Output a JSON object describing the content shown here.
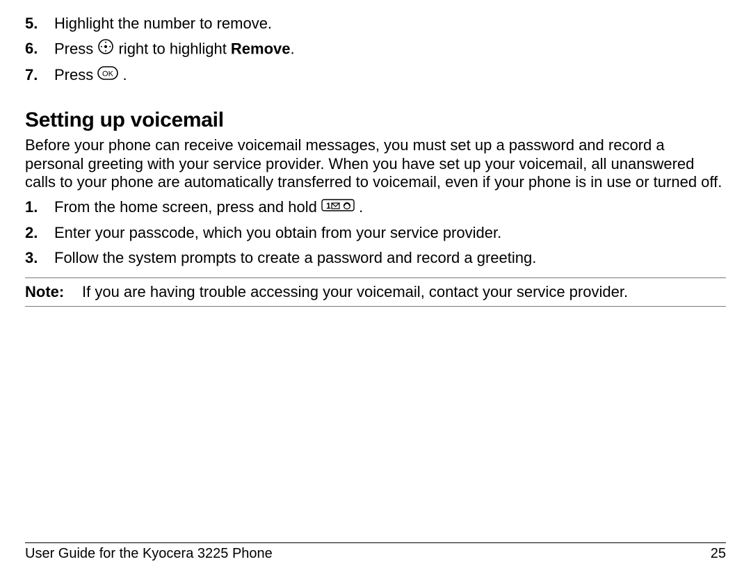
{
  "steps_a": [
    {
      "n": "5.",
      "text": "Highlight the number to remove."
    },
    {
      "n": "6.",
      "pre": "Press ",
      "mid": " right to highlight ",
      "bold": "Remove",
      "post": "."
    },
    {
      "n": "7.",
      "pre": "Press ",
      "post": " ."
    }
  ],
  "section_title": "Setting up voicemail",
  "section_body": "Before your phone can receive voicemail messages, you must set up a password and record a personal greeting with your service provider. When you have set up your voicemail, all unanswered calls to your phone are automatically transferred to voicemail, even if your phone is in use or turned off.",
  "steps_b": [
    {
      "n": "1.",
      "pre": "From the home screen, press and hold ",
      "post": " ."
    },
    {
      "n": "2.",
      "text": "Enter your passcode, which you obtain from your service provider."
    },
    {
      "n": "3.",
      "text": "Follow the system prompts to create a password and record a greeting."
    }
  ],
  "note": {
    "label": "Note:",
    "text": "If you are having trouble accessing your voicemail, contact your service provider."
  },
  "footer": {
    "left": "User Guide for the Kyocera 3225 Phone",
    "right": "25"
  }
}
